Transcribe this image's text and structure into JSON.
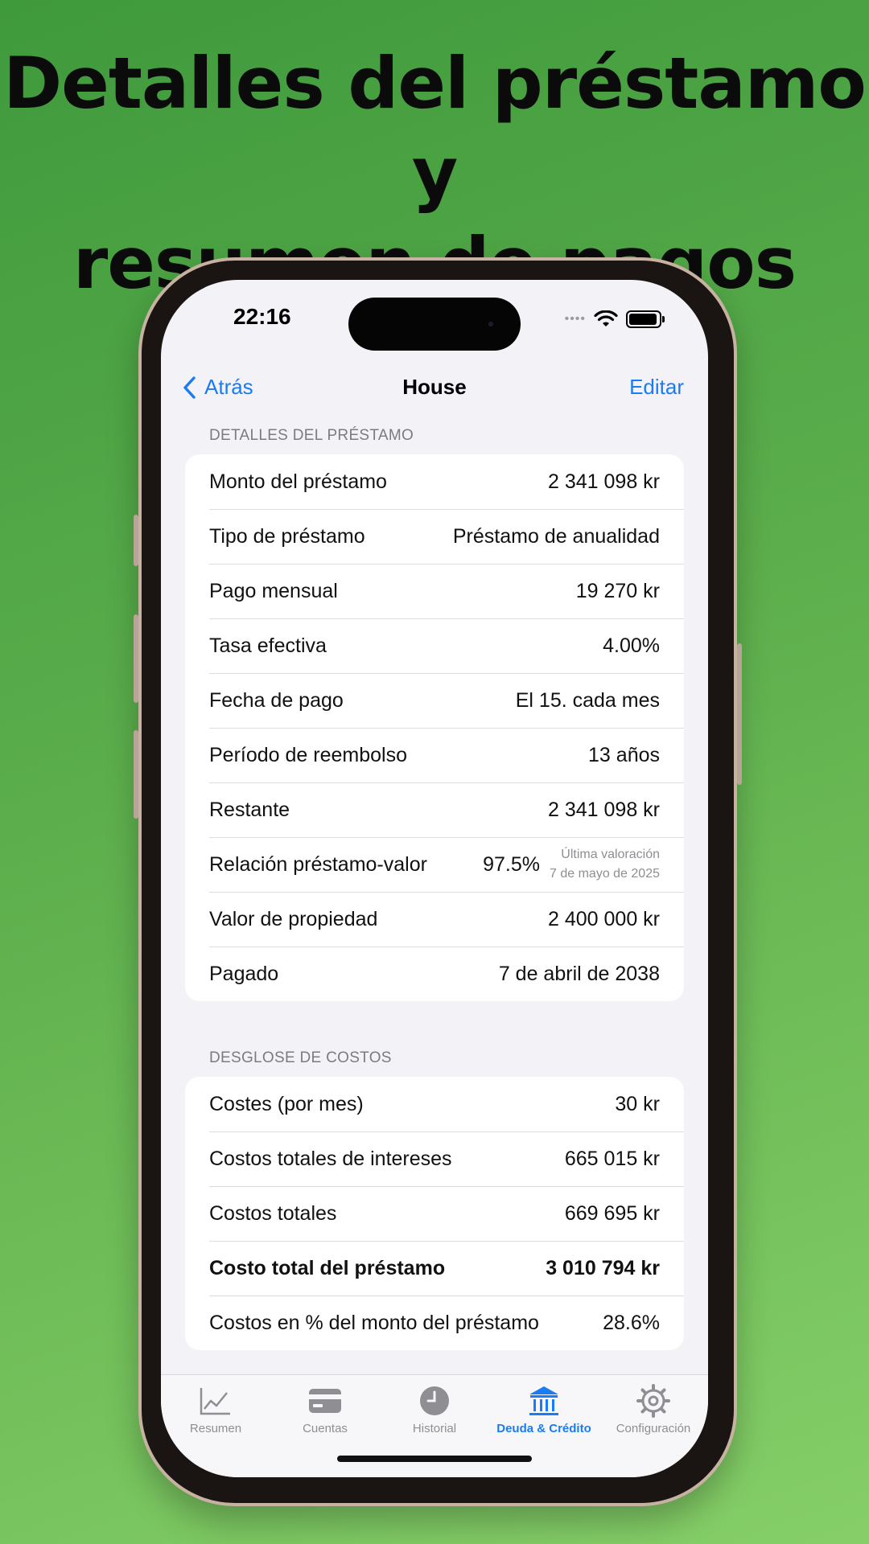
{
  "headline": {
    "line1": "Detalles del préstamo y",
    "line2": "resumen de pagos"
  },
  "status_bar": {
    "time": "22:16",
    "signal": "••••"
  },
  "nav": {
    "back_label": "Atrás",
    "title": "House",
    "edit_label": "Editar"
  },
  "loan_details": {
    "header": "DETALLES DEL PRÉSTAMO",
    "rows": [
      {
        "label": "Monto del préstamo",
        "value": "2 341 098 kr"
      },
      {
        "label": "Tipo de préstamo",
        "value": "Préstamo de anualidad"
      },
      {
        "label": "Pago mensual",
        "value": "19 270 kr"
      },
      {
        "label": "Tasa efectiva",
        "value": "4.00%"
      },
      {
        "label": "Fecha de pago",
        "value": "El 15. cada mes"
      },
      {
        "label": "Período de reembolso",
        "value": "13 años"
      },
      {
        "label": "Restante",
        "value": "2 341 098 kr"
      }
    ],
    "ltv": {
      "label": "Relación préstamo-valor",
      "value": "97.5%",
      "note_line1": "Última valoración",
      "note_line2": "7 de mayo de 2025"
    },
    "rows_after": [
      {
        "label": "Valor de propiedad",
        "value": "2 400 000 kr"
      },
      {
        "label": "Pagado",
        "value": "7 de abril de 2038"
      }
    ]
  },
  "cost_breakdown": {
    "header": "DESGLOSE DE COSTOS",
    "rows": [
      {
        "label": "Costes (por mes)",
        "value": "30 kr"
      },
      {
        "label": "Costos totales de intereses",
        "value": "665 015 kr"
      },
      {
        "label": "Costos totales",
        "value": "669 695 kr"
      },
      {
        "label": "Costo total del préstamo",
        "value": "3 010 794 kr"
      },
      {
        "label": "Costos en % del monto del préstamo",
        "value": "28.6%"
      }
    ]
  },
  "tabbar": {
    "tabs": [
      {
        "label": "Resumen",
        "icon": "chart-line-icon"
      },
      {
        "label": "Cuentas",
        "icon": "card-icon"
      },
      {
        "label": "Historial",
        "icon": "clock-icon"
      },
      {
        "label": "Deuda & Crédito",
        "icon": "bank-icon",
        "active": true
      },
      {
        "label": "Configuración",
        "icon": "gear-icon"
      }
    ]
  },
  "colors": {
    "accent": "#1a7cf4",
    "background": "#f2f2f7",
    "card": "#ffffff",
    "muted": "#8e8e93"
  }
}
